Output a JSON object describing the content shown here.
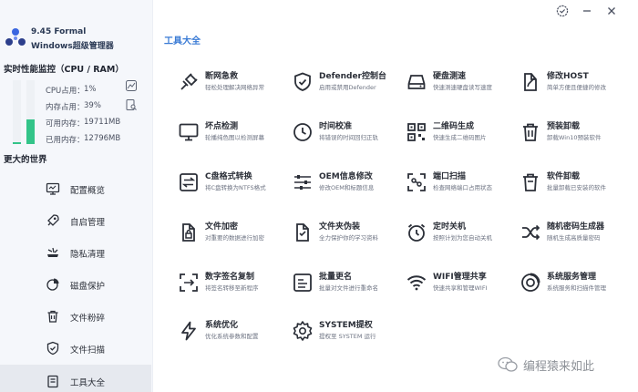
{
  "app": {
    "version": "9.45 Formal",
    "name": "Windows超级管理器"
  },
  "perf": {
    "title": "实时性能监控（CPU / RAM）",
    "cpu_label": "CPU占用：",
    "cpu_value": "1%",
    "cpu_fraction": 0.01,
    "mem_label": "内存占用：",
    "mem_value": "39%",
    "mem_fraction": 0.39,
    "avail_label": "可用内存：",
    "avail_value": "19711MB",
    "used_label": "已用内存：",
    "used_value": "12796MB"
  },
  "sidebar": {
    "section_title": "更大的世界",
    "items": [
      {
        "label": "配置概览",
        "icon": "monitor-icon"
      },
      {
        "label": "自启管理",
        "icon": "rocket-icon"
      },
      {
        "label": "隐私清理",
        "icon": "broom-icon"
      },
      {
        "label": "磁盘保护",
        "icon": "pie-chart-icon"
      },
      {
        "label": "文件粉碎",
        "icon": "trash-icon"
      },
      {
        "label": "文件扫描",
        "icon": "shield-check-icon"
      },
      {
        "label": "工具大全",
        "icon": "toolbox-icon",
        "active": true
      }
    ]
  },
  "main": {
    "title": "工具大全",
    "tools": [
      {
        "name": "断网急救",
        "desc": "轻松处理解决网络异常",
        "icon": "plug-icon"
      },
      {
        "name": "Defender控制台",
        "desc": "启用或禁用Defender",
        "icon": "shield-icon"
      },
      {
        "name": "硬盘测速",
        "desc": "快速测速硬盘读写速度",
        "icon": "hard-drive-icon"
      },
      {
        "name": "修改HOST",
        "desc": "简单方便且便捷的修改",
        "icon": "edit-file-icon"
      },
      {
        "name": "坏点检测",
        "desc": "轮播纯色图以检测屏幕",
        "icon": "screen-icon"
      },
      {
        "name": "时间校准",
        "desc": "将错误的时间回归正轨",
        "icon": "clock-icon"
      },
      {
        "name": "二维码生成",
        "desc": "快速生成二维码图片",
        "icon": "qrcode-icon"
      },
      {
        "name": "预装卸载",
        "desc": "卸载Win10预装软件",
        "icon": "uninstall-icon"
      },
      {
        "name": "C盘格式转换",
        "desc": "将C盘转换为NTFS格式",
        "icon": "convert-icon"
      },
      {
        "name": "OEM信息修改",
        "desc": "修改OEM和标题信息",
        "icon": "sliders-icon"
      },
      {
        "name": "端口扫描",
        "desc": "检查网络端口占用状态",
        "icon": "scan-icon"
      },
      {
        "name": "软件卸载",
        "desc": "批量卸载已安装的软件",
        "icon": "trash-icon"
      },
      {
        "name": "文件加密",
        "desc": "对重要的数据进行加密",
        "icon": "file-lock-icon"
      },
      {
        "name": "文件夹伪装",
        "desc": "全力保护你的学习资料",
        "icon": "folder-icon"
      },
      {
        "name": "定时关机",
        "desc": "按照计划为您自动关机",
        "icon": "alarm-icon"
      },
      {
        "name": "随机密码生成器",
        "desc": "随机生成高质量密码",
        "icon": "shuffle-icon"
      },
      {
        "name": "数字签名复制",
        "desc": "将签名转移至新程序",
        "icon": "signature-copy-icon"
      },
      {
        "name": "批量更名",
        "desc": "批量对文件进行重命名",
        "icon": "rename-icon"
      },
      {
        "name": "WIFI管理共享",
        "desc": "快速共享和管理WIFI",
        "icon": "wifi-icon"
      },
      {
        "name": "系统服务管理",
        "desc": "系统服务和扫描件管理",
        "icon": "service-icon"
      },
      {
        "name": "系统优化",
        "desc": "优化系统参数和配置",
        "icon": "bolt-icon"
      },
      {
        "name": "SYSTEM提权",
        "desc": "提权至 SYSTEM 运行",
        "icon": "gear-icon"
      }
    ]
  },
  "watermark": {
    "text": "编程猿来如此"
  },
  "colors": {
    "accent": "#3a7bd5",
    "gauge_green": "#33c489",
    "sidebar_bg": "#f5f7fb"
  }
}
